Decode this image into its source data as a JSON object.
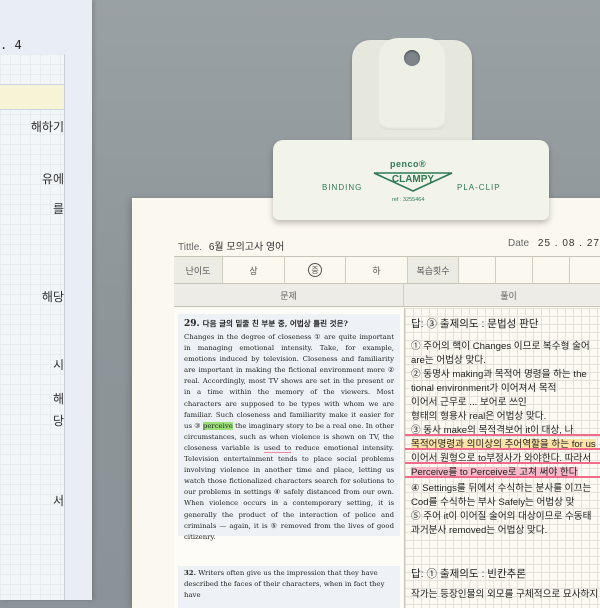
{
  "left_notebook": {
    "date": ". 4",
    "handwriting": [
      "해하기",
      "유에",
      "를",
      "해당",
      "시",
      "해",
      "당",
      "서"
    ]
  },
  "worksheet": {
    "title_label": "Tittle.",
    "title_value": "6월 모의고사 영어",
    "date_label": "Date",
    "date_value": "25 . 08 . 27",
    "difficulty_label": "난이도",
    "difficulty_options": [
      "상",
      "중",
      "하"
    ],
    "review_label": "복습횟수",
    "problem_header": "문제",
    "solution_header": "풀이",
    "q29": {
      "number": "29.",
      "prompt": "다음 글의 밑줄 친 부분 중, 어법상 틀린 것은?",
      "text_before": "Changes in the degree of closeness ① are quite important in managing emotional intensity. Take, for example, emotions induced by television. Closeness and familiarity are important in making the fictional environment more ② real. Accordingly, most TV shows are set in the present or in a time within the memory of the viewers. Most characters are supposed to be types with whom we are familiar. Such closeness and familiarity make it easier for us ③",
      "highlight": "perceive",
      "text_mid": "the imaginary story to be a real one. In other circumstances, such as when violence is shown on TV, the closeness variable is",
      "underlined": "used to",
      "text_after": "reduce emotional intensity. Television entertainment tends to place social problems involving violence in another time and place, letting us watch those fictionalized characters search for solutions to our problems in settings ④ safely distanced from our own. When violence occurs in a contemporary setting, it is generally the product of the interaction of police and criminals — again, it is ⑤ removed from the lives of good citizenry."
    },
    "q32": {
      "number": "32.",
      "text": "Writers often give us the impression that they have described the faces of their characters, when in fact they have"
    },
    "solution_lines": [
      "답: ③   출제의도 : 문법성 판단",
      "① 주어의 핵이 Changes 이므로 복수형 술어",
      "   are는 어법상 맞다.",
      "② 동명사 making과 목적어 명령을 하는 the",
      "   tional environment가 이어져서 목적",
      "   이어서 근무로 ... 보어로 쓰인",
      "   형태의 형용사 real은 어법상 맞다.",
      "③ 동사 make의 목적격보어 it이 대상, 나",
      "   목적어명령과 의미상의 주어역할을 하는 for us",
      "   이어서 원형으로 to부정사가 와야한다. 따라서",
      "   Perceive를 to Perceive로 고쳐 써야 한다",
      "④ Settings를 뒤에서 수식하는 분사를 이끄는",
      "   Cod를 수식하는 부사 Safely는 어법상 맞",
      "⑤ 주어 it이 이어질 술어의 대상이므로 수동태",
      "   과거분사 removed는 어법상 맞다.",
      "답: ①   출제의도 : 빈칸추론",
      "   작가는 등장인물의 외모를 구체적으로 묘사하지 않"
    ]
  },
  "clip": {
    "brand": "penco®",
    "logo": "CLAMPY",
    "left_text": "BINDING",
    "right_text": "PLA-CLIP",
    "ref": "ref : 3255464"
  },
  "colors": {
    "highlight_green": "#9be07a",
    "marker_pink": "#f26b8a",
    "marker_yellow": "#fde3a8",
    "clip_green": "#2f7a55"
  }
}
